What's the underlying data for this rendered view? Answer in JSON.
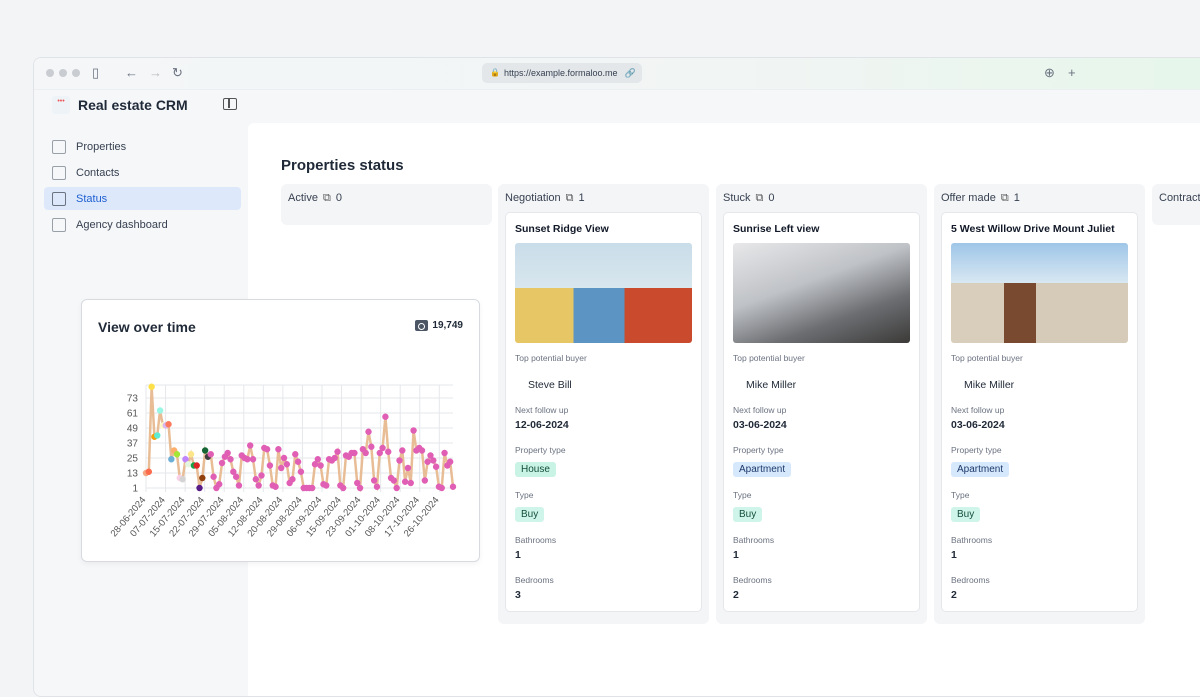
{
  "browser": {
    "url": "https://example.formaloo.me"
  },
  "app": {
    "title": "Real estate CRM"
  },
  "sidebar": {
    "items": [
      {
        "label": "Properties",
        "icon": "building-icon"
      },
      {
        "label": "Contacts",
        "icon": "users-icon"
      },
      {
        "label": "Status",
        "icon": "inbox-icon",
        "active": true
      },
      {
        "label": "Agency dashboard",
        "icon": "chart-icon"
      }
    ]
  },
  "main": {
    "title": "Properties status"
  },
  "columns": [
    {
      "name": "Active",
      "count": "0",
      "cards": []
    },
    {
      "name": "Negotiation",
      "count": "1",
      "cards": [
        {
          "title": "Sunset Ridge View",
          "buyer_label": "Top potential buyer",
          "buyer": "Steve Bill",
          "follow_label": "Next follow up",
          "follow": "12-06-2024",
          "ptype_label": "Property type",
          "ptype": "House",
          "type_label": "Type",
          "type": "Buy",
          "bath_label": "Bathrooms",
          "bath": "1",
          "bed_label": "Bedrooms",
          "bed": "3"
        }
      ]
    },
    {
      "name": "Stuck",
      "count": "0",
      "cards": [
        {
          "title": "Sunrise Left view",
          "buyer_label": "Top potential buyer",
          "buyer": "Mike Miller",
          "follow_label": "Next follow up",
          "follow": "03-06-2024",
          "ptype_label": "Property type",
          "ptype": "Apartment",
          "type_label": "Type",
          "type": "Buy",
          "bath_label": "Bathrooms",
          "bath": "1",
          "bed_label": "Bedrooms",
          "bed": "2"
        }
      ]
    },
    {
      "name": "Offer made",
      "count": "1",
      "cards": [
        {
          "title": "5 West Willow Drive Mount Juliet",
          "buyer_label": "Top potential buyer",
          "buyer": "Mike Miller",
          "follow_label": "Next follow up",
          "follow": "03-06-2024",
          "ptype_label": "Property type",
          "ptype": "Apartment",
          "type_label": "Type",
          "type": "Buy",
          "bath_label": "Bathrooms",
          "bath": "1",
          "bed_label": "Bedrooms",
          "bed": "2"
        }
      ]
    },
    {
      "name": "Contract",
      "count": "",
      "cards": []
    }
  ],
  "widget": {
    "title": "View over time",
    "total": "19,749",
    "icon": "eye-icon"
  },
  "chart_data": {
    "type": "line",
    "title": "View over time",
    "y_ticks": [
      1,
      13,
      25,
      37,
      49,
      61,
      73
    ],
    "ylim": [
      1,
      85
    ],
    "x_tick_labels": [
      "28-06-2024",
      "07-07-2024",
      "15-07-2024",
      "22-07-2024",
      "29-07-2024",
      "05-08-2024",
      "12-08-2024",
      "20-08-2024",
      "29-08-2024",
      "06-09-2024",
      "15-09-2024",
      "23-09-2024",
      "01-10-2024",
      "08-10-2024",
      "17-10-2024",
      "26-10-2024"
    ],
    "grid": true,
    "line_color": "#e8bd96",
    "point_color": "#e05fb5",
    "values": [
      13,
      14,
      82,
      42,
      43,
      63,
      51,
      51,
      52,
      24,
      31,
      28,
      9,
      8,
      24,
      20,
      28,
      19,
      19,
      1,
      9,
      31,
      26,
      28,
      10,
      1,
      4,
      21,
      26,
      29,
      24,
      14,
      10,
      3,
      27,
      25,
      24,
      35,
      24,
      8,
      3,
      11,
      33,
      32,
      19,
      3,
      2,
      32,
      17,
      25,
      20,
      5,
      8,
      28,
      22,
      14,
      1,
      1,
      1,
      1,
      20,
      24,
      19,
      4,
      3,
      24,
      23,
      25,
      30,
      3,
      1,
      27,
      26,
      29,
      29,
      5,
      1,
      32,
      29,
      46,
      34,
      7,
      2,
      29,
      33,
      58,
      30,
      9,
      7,
      1,
      23,
      31,
      6,
      17,
      5,
      47,
      31,
      33,
      31,
      7,
      22,
      27,
      23,
      18,
      2,
      1,
      29,
      19,
      22,
      2
    ],
    "early_point_colors": [
      "#f4a582",
      "#fb6a4a",
      "#fde047",
      "#f59e0b",
      "#5eead4",
      "#99f6e4",
      "#fef9c3",
      "#d9b8f0",
      "#fb7a5e",
      "#6baed6",
      "#fdae6b",
      "#a3e635",
      "#fbcfe8",
      "#d4d4d4",
      "#c084fc",
      "#e5f5e0",
      "#fde68a",
      "#16a34a",
      "#dc2626",
      "#581c87",
      "#92400e",
      "#166534",
      "#404040"
    ]
  }
}
